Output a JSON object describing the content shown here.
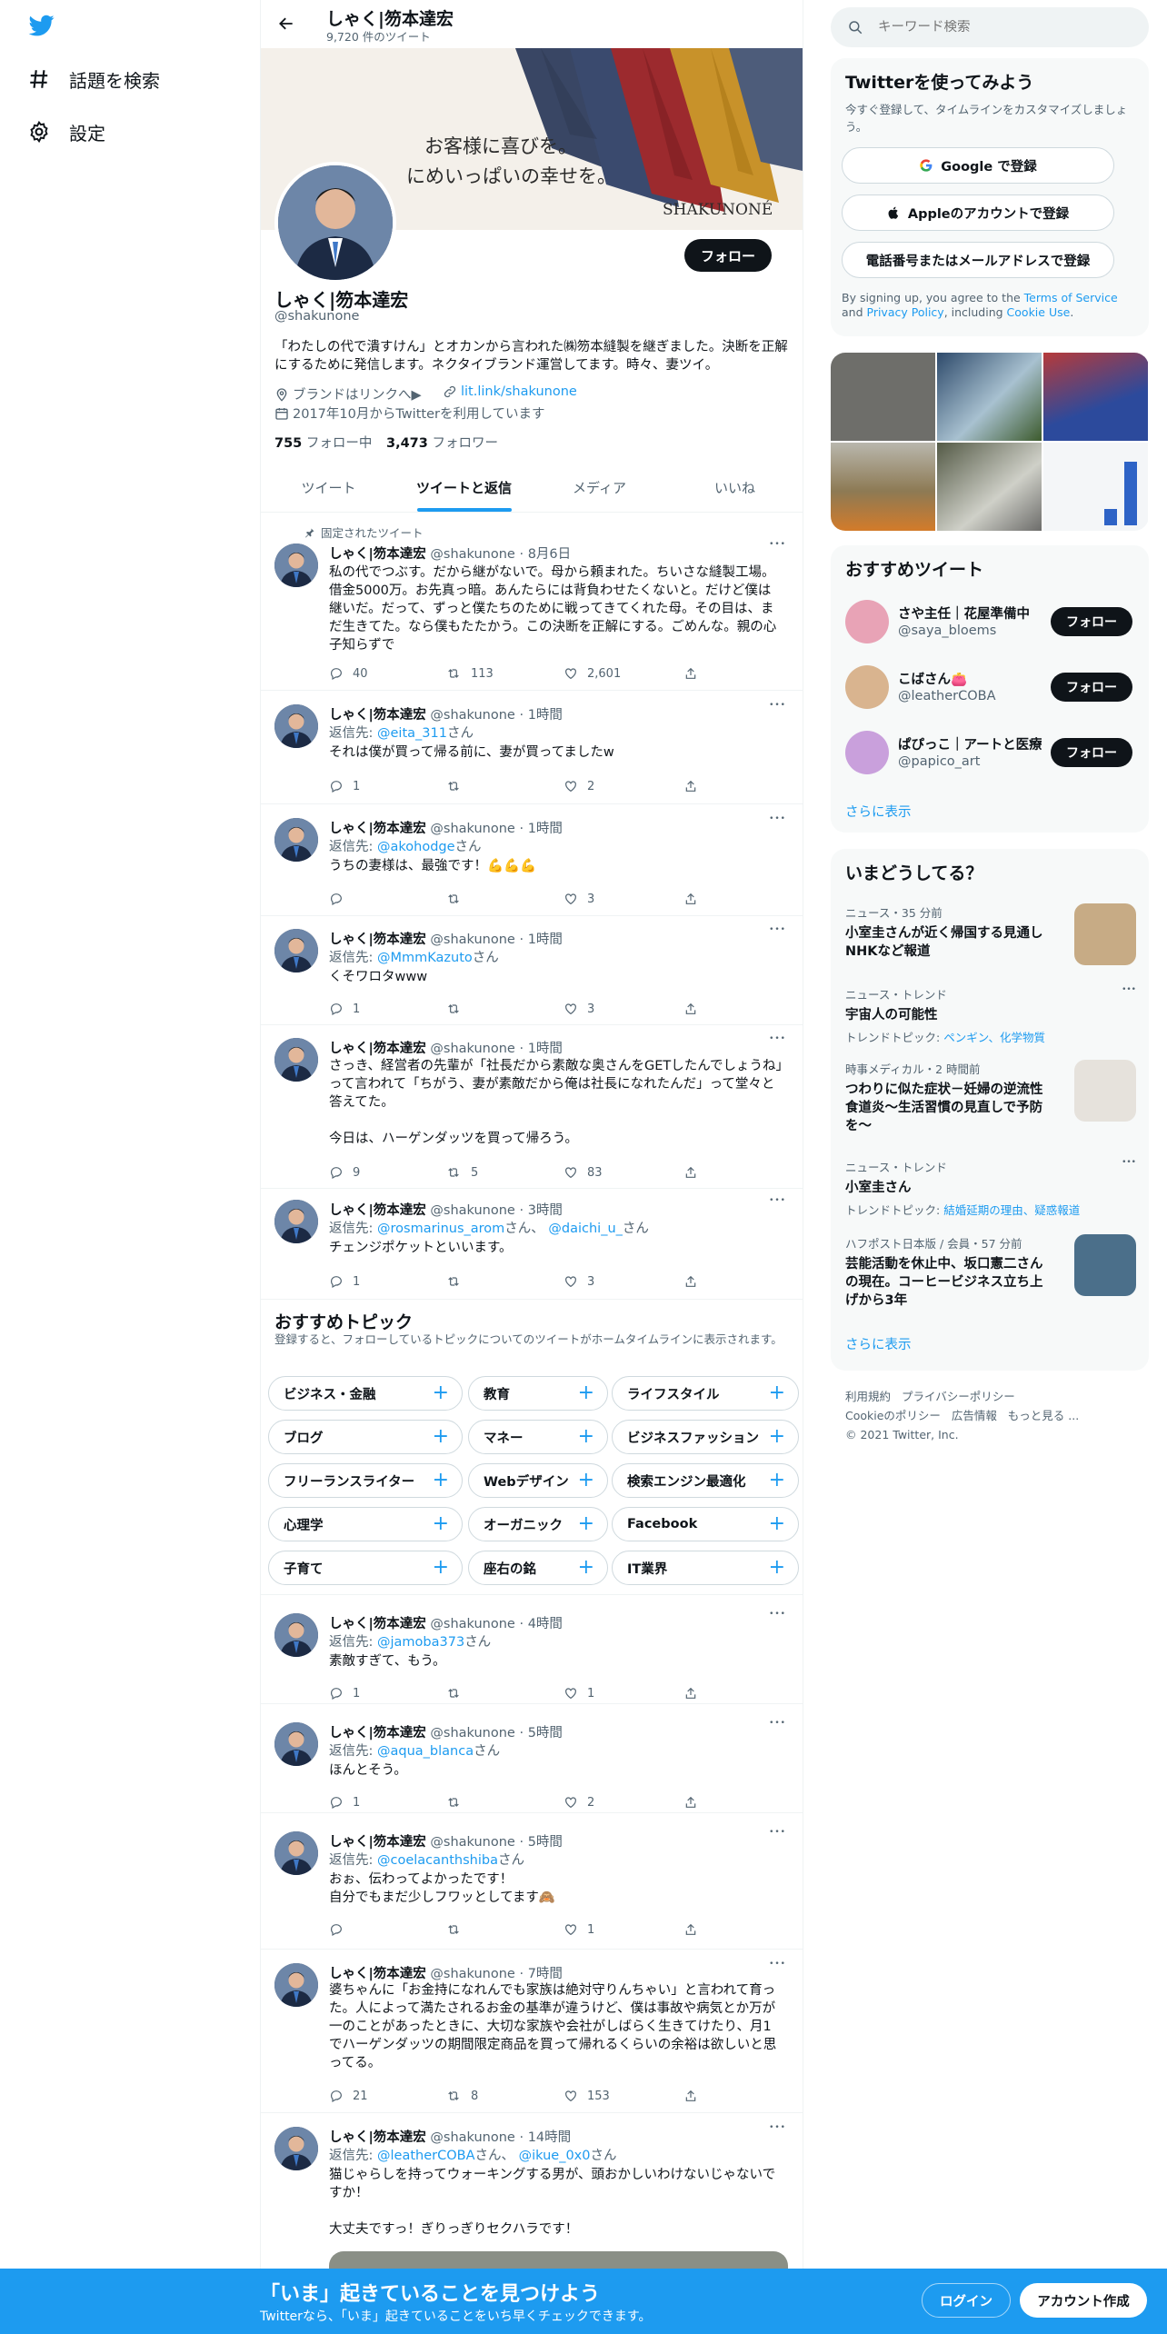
{
  "nav": {
    "explore_label": "話題を検索",
    "settings_label": "設定"
  },
  "header": {
    "name": "しゃく|笏本達宏",
    "tweet_count": "9,720 件のツイート"
  },
  "banner": {
    "line1": "お客様に喜びを。",
    "line2": "にめいっぱいの幸せを。",
    "brand": "SHAKUNONÉ"
  },
  "profile": {
    "follow_label": "フォロー",
    "name": "しゃく|笏本達宏",
    "handle": "@shakunone",
    "bio": "「わたしの代で潰すけん」とオカンから言われた㈱笏本縫製を継ぎました。決断を正解にするために発信します。ネクタイブランド運営してます。時々、妻ツイ。",
    "location": "ブランドはリンクへ▶",
    "url": "lit.link/shakunone",
    "joined": "2017年10月からTwitterを利用しています",
    "following_count": "755",
    "following_label": "フォロー中",
    "followers_count": "3,473",
    "followers_label": "フォロワー"
  },
  "tabs": [
    "ツイート",
    "ツイートと返信",
    "メディア",
    "いいね"
  ],
  "pinned_label": "固定されたツイート",
  "tweets": [
    {
      "name": "しゃく|笏本達宏",
      "handle": "@shakunone",
      "time": "8月6日",
      "reply_to": "",
      "text": "私の代でつぶす。だから継がないで。母から頼まれた。ちいさな縫製工場。借金5000万。お先真っ暗。あんたらには背負わせたくないと。だけど僕は継いだ。だって、ずっと僕たちのために戦ってきてくれた母。その目は、まだ生きてた。なら僕もたたかう。この決断を正解にする。ごめんな。親の心子知らずで",
      "replies": "40",
      "retweets": "113",
      "likes": "2,601"
    },
    {
      "name": "しゃく|笏本達宏",
      "handle": "@shakunone",
      "time": "1時間",
      "reply_to": "@eita_311",
      "text": "それは僕が買って帰る前に、妻が買ってましたw",
      "replies": "1",
      "retweets": "",
      "likes": "2"
    },
    {
      "name": "しゃく|笏本達宏",
      "handle": "@shakunone",
      "time": "1時間",
      "reply_to": "@akohodge",
      "text": "うちの妻様は、最強です！💪💪💪",
      "replies": "",
      "retweets": "",
      "likes": "3"
    },
    {
      "name": "しゃく|笏本達宏",
      "handle": "@shakunone",
      "time": "1時間",
      "reply_to": "@MmmKazuto",
      "text": "くそワロタwww",
      "replies": "1",
      "retweets": "",
      "likes": "3"
    },
    {
      "name": "しゃく|笏本達宏",
      "handle": "@shakunone",
      "time": "1時間",
      "reply_to": "",
      "text": "さっき、経営者の先輩が「社長だから素敵な奥さんをGETしたんでしょうね」って言われて「ちがう、妻が素敵だから俺は社長になれたんだ」って堂々と答えてた。\n\n今日は、ハーゲンダッツを買って帰ろう。",
      "replies": "9",
      "retweets": "5",
      "likes": "83"
    },
    {
      "name": "しゃく|笏本達宏",
      "handle": "@shakunone",
      "time": "3時間",
      "reply_to": "@rosmarinus_arom",
      "reply_to2": "@daichi_u_",
      "text": "チェンジポケットといいます。",
      "replies": "1",
      "retweets": "",
      "likes": "3"
    },
    {
      "name": "しゃく|笏本達宏",
      "handle": "@shakunone",
      "time": "4時間",
      "reply_to": "@jamoba373",
      "text": "素敵すぎて、もう。",
      "replies": "1",
      "retweets": "",
      "likes": "1"
    },
    {
      "name": "しゃく|笏本達宏",
      "handle": "@shakunone",
      "time": "5時間",
      "reply_to": "@aqua_blanca",
      "text": "ほんとそう。",
      "replies": "1",
      "retweets": "",
      "likes": "2"
    },
    {
      "name": "しゃく|笏本達宏",
      "handle": "@shakunone",
      "time": "5時間",
      "reply_to": "@coelacanthshiba",
      "text": "おぉ、伝わってよかったです！\n自分でもまだ少しフワッとしてます🙈",
      "replies": "",
      "retweets": "",
      "likes": "1"
    },
    {
      "name": "しゃく|笏本達宏",
      "handle": "@shakunone",
      "time": "7時間",
      "reply_to": "",
      "text": "婆ちゃんに「お金持になれんでも家族は絶対守りんちゃい」と言われて育った。人によって満たされるお金の基準が違うけど、僕は事故や病気とか万が一のことがあったときに、大切な家族や会社がしばらく生きてけたり、月1でハーゲンダッツの期間限定商品を買って帰れるくらいの余裕は欲しいと思ってる。",
      "replies": "21",
      "retweets": "8",
      "likes": "153"
    },
    {
      "name": "しゃく|笏本達宏",
      "handle": "@shakunone",
      "time": "14時間",
      "reply_to": "@leatherCOBA",
      "reply_to2": "@ikue_0x0",
      "text": "猫じゃらしを持ってウォーキングする男が、頭おかしいわけないじゃないですか！\n\n大丈夫ですっ！ぎりっぎりセクハラです！",
      "replies": "",
      "retweets": "",
      "likes": ""
    }
  ],
  "reply_prefix": "返信先:",
  "reply_suffix": "さん",
  "reply_and": "さん、",
  "topics": {
    "title": "おすすめトピック",
    "subtitle": "登録すると、フォローしているトピックについてのツイートがホームタイムラインに表示されます。",
    "items": [
      "ビジネス・金融",
      "教育",
      "ライフスタイル",
      "ブログ",
      "マネー",
      "ビジネスファッション",
      "フリーランスライター",
      "Webデザイン",
      "検索エンジン最適化",
      "心理学",
      "オーガニック",
      "Facebook",
      "子育て",
      "座右の銘",
      "IT業界"
    ]
  },
  "search": {
    "placeholder": "キーワード検索"
  },
  "signup": {
    "title": "Twitterを使ってみよう",
    "subtitle": "今すぐ登録して、タイムラインをカスタマイズしましょう。",
    "google": "Google で登録",
    "apple": "Appleのアカウントで登録",
    "phone": "電話番号またはメールアドレスで登録",
    "legal_pre": "By signing up, you agree to the ",
    "terms": "Terms of Service",
    "legal_and": " and ",
    "privacy": "Privacy Policy",
    "legal_incl": ", including ",
    "cookie": "Cookie Use",
    "legal_end": "."
  },
  "who_to_follow": {
    "title": "おすすめツイート",
    "users": [
      {
        "name": "さや主任｜花屋準備中",
        "handle": "@saya_bloems"
      },
      {
        "name": "こばさん👛",
        "handle": "@leatherCOBA"
      },
      {
        "name": "ぱぴっこ｜アートと医療",
        "handle": "@papico_art"
      }
    ],
    "follow_label": "フォロー",
    "more": "さらに表示"
  },
  "trends": {
    "title": "いまどうしてる？",
    "items": [
      {
        "meta": "ニュース・35 分前",
        "title": "小室圭さんが近く帰国する見通し NHKなど報道",
        "sub": ""
      },
      {
        "meta": "ニュース・トレンド",
        "title": "宇宙人の可能性",
        "sub_label": "トレンドトピック: ",
        "sub": "ペンギン、化学物質"
      },
      {
        "meta": "時事メディカル・2 時間前",
        "title": "つわりに似た症状－妊婦の逆流性食道炎～生活習慣の見直しで予防を～",
        "sub": ""
      },
      {
        "meta": "ニュース・トレンド",
        "title": "小室圭さん",
        "sub_label": "トレンドトピック: ",
        "sub": "結婚延期の理由、疑惑報道"
      },
      {
        "meta": "ハフポスト日本版 / 会員・57 分前",
        "title": "芸能活動を休止中、坂口憲二さんの現在。コーヒービジネス立ち上げから3年",
        "sub": ""
      }
    ],
    "more": "さらに表示"
  },
  "footer": {
    "links": [
      "利用規約",
      "プライバシーポリシー",
      "Cookieのポリシー",
      "広告情報",
      "もっと見る ..."
    ],
    "copyright": "© 2021 Twitter, Inc."
  },
  "bottom_bar": {
    "title": "「いま」起きていることを見つけよう",
    "subtitle": "Twitterなら、「いま」起きていることをいち早くチェックできます。",
    "login": "ログイン",
    "signup": "アカウント作成"
  },
  "colors": {
    "accent": "#1d9bf0",
    "text": "#0f1419",
    "muted": "#536471"
  }
}
